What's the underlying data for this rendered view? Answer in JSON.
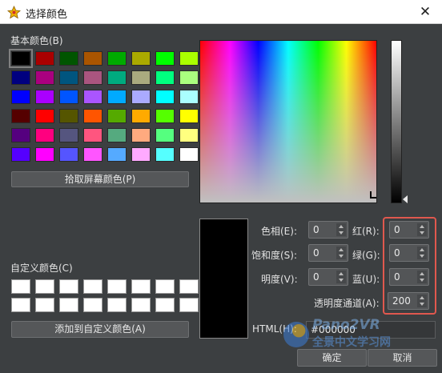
{
  "window": {
    "title": "选择颜色",
    "close_label": "✕"
  },
  "basic_colors": {
    "label": "基本颜色(B)",
    "swatches": [
      "#000000",
      "#aa0000",
      "#005500",
      "#aa5500",
      "#00aa00",
      "#aaaa00",
      "#00ff00",
      "#aaff00",
      "#00007f",
      "#aa007f",
      "#00557f",
      "#aa557f",
      "#00aa7f",
      "#aaaa7f",
      "#00ff7f",
      "#aaff7f",
      "#0000ff",
      "#aa00ff",
      "#0055ff",
      "#aa55ff",
      "#00aaff",
      "#aaaaff",
      "#00ffff",
      "#aaffff",
      "#550000",
      "#ff0000",
      "#555500",
      "#ff5500",
      "#55aa00",
      "#ffaa00",
      "#55ff00",
      "#ffff00",
      "#55007f",
      "#ff007f",
      "#55557f",
      "#ff557f",
      "#55aa7f",
      "#ffaa7f",
      "#55ff7f",
      "#ffff7f",
      "#5500ff",
      "#ff00ff",
      "#5555ff",
      "#ff55ff",
      "#55aaff",
      "#ffaaff",
      "#55ffff",
      "#ffffff"
    ],
    "selected_index": 0
  },
  "pick_screen_button": "拾取屏幕颜色(P)",
  "custom_colors": {
    "label": "自定义颜色(C)",
    "count": 16
  },
  "add_custom_button": "添加到自定义颜色(A)",
  "fields": {
    "hue": {
      "label": "色相(E):",
      "value": "0"
    },
    "saturation": {
      "label": "饱和度(S):",
      "value": "0"
    },
    "value": {
      "label": "明度(V):",
      "value": "0"
    },
    "red": {
      "label": "红(R):",
      "value": "0"
    },
    "green": {
      "label": "绿(G):",
      "value": "0"
    },
    "blue": {
      "label": "蓝(U):",
      "value": "0"
    },
    "alpha": {
      "label": "透明度通道(A):",
      "value": "200"
    },
    "html": {
      "label": "HTML(H):",
      "value": "#000000"
    }
  },
  "current_color": "#000000",
  "highlight_color": "#e0584e",
  "buttons": {
    "ok": "确定",
    "cancel": "取消"
  },
  "watermark": {
    "line1": "Pano2VR",
    "line2": "全景中文学习网"
  }
}
